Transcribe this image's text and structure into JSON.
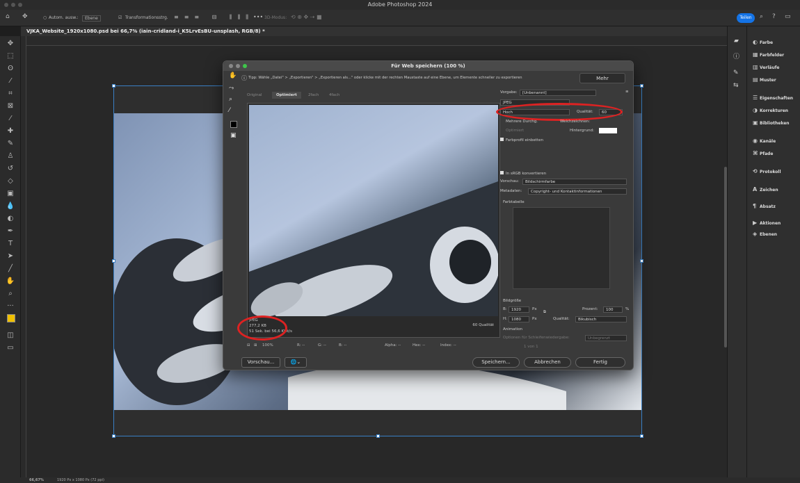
{
  "app": {
    "window_title": "Adobe Photoshop 2024",
    "share_label": "Teilen"
  },
  "options_bar": {
    "auto_select": "Autom. ausw.:",
    "layer_select": "Ebene",
    "transform_controls": "Transformationsstrg.",
    "mode_3d": "3D-Modus:"
  },
  "document_tab": {
    "title": "VJKA_Website_1920x1080.psd bei 66,7% (iain-cridland-i_K5LrvEsBU-unsplash, RGB/8) *"
  },
  "status_bar": {
    "zoom": "66,67%",
    "doc_size": "1920 Px x 1080 Px (72 ppi)"
  },
  "right_panels": [
    {
      "icon": "color-icon",
      "label": "Farbe"
    },
    {
      "icon": "swatches-icon",
      "label": "Farbfelder"
    },
    {
      "icon": "gradients-icon",
      "label": "Verläufe"
    },
    {
      "icon": "patterns-icon",
      "label": "Muster"
    },
    {
      "icon": "properties-icon",
      "label": "Eigenschaften"
    },
    {
      "icon": "adjustments-icon",
      "label": "Korrekturen"
    },
    {
      "icon": "libraries-icon",
      "label": "Bibliotheken"
    },
    {
      "icon": "channels-icon",
      "label": "Kanäle"
    },
    {
      "icon": "paths-icon",
      "label": "Pfade"
    },
    {
      "icon": "history-icon",
      "label": "Protokoll"
    },
    {
      "icon": "character-icon",
      "label": "Zeichen"
    },
    {
      "icon": "paragraph-icon",
      "label": "Absatz"
    },
    {
      "icon": "actions-icon",
      "label": "Aktionen"
    },
    {
      "icon": "layers-icon",
      "label": "Ebenen"
    }
  ],
  "dialog": {
    "title": "Für Web speichern (100 %)",
    "tip": "Tipp: Wähle „Datei\" > „Exportieren\" > „Exportieren als...\" oder klicke mit der rechten Maustaste auf eine Ebene, um Elemente schneller zu exportieren",
    "more_label": "Mehr",
    "tabs": [
      "Original",
      "Optimiert",
      "2fach",
      "4fach"
    ],
    "preview": {
      "format": "JPEG",
      "size": "277,2 KB",
      "speed": "51 Sek. bei 56,6 Kbit/s",
      "quality_note": "60 Qualität"
    },
    "info": {
      "zoom": "100%",
      "r": "R: --",
      "g": "G: --",
      "b": "B: --",
      "alpha": "Alpha: --",
      "hex": "Hex: --",
      "index": "Index: --"
    },
    "buttons": {
      "preview": "Vorschau...",
      "save": "Speichern...",
      "cancel": "Abbrechen",
      "done": "Fertig"
    },
    "settings": {
      "preset_label": "Vorgabe:",
      "preset_value": "[Unbenannt]",
      "format_value": "JPEG",
      "quality_level": "Hoch",
      "quality_label": "Qualität:",
      "quality_value": "60",
      "progressive": "Mehrere Durchg.",
      "blur_label": "Weichzeichnen:",
      "optimized": "Optimiert",
      "matte_label": "Hintergrund:",
      "embed_profile": "Farbprofil einbetten",
      "convert_srgb": "In sRGB konvertieren",
      "preview_label": "Vorschau:",
      "preview_value": "Bildschirmfarbe",
      "metadata_label": "Metadaten:",
      "metadata_value": "Copyright- und Kontaktinformationen",
      "color_table": "Farbtabelle",
      "image_size": "Bildgröße",
      "width_label": "B:",
      "width_value": "1920",
      "height_label": "H:",
      "height_value": "1080",
      "unit": "Px",
      "percent_label": "Prozent:",
      "percent_value": "100",
      "percent_unit": "%",
      "resample_label": "Qualität:",
      "resample_value": "Bikubisch",
      "animation": "Animation",
      "loop_label": "Optionen für Schleifenwiedergabe:",
      "loop_value": "Unbegrenzt",
      "frame": "1 von 1"
    }
  }
}
